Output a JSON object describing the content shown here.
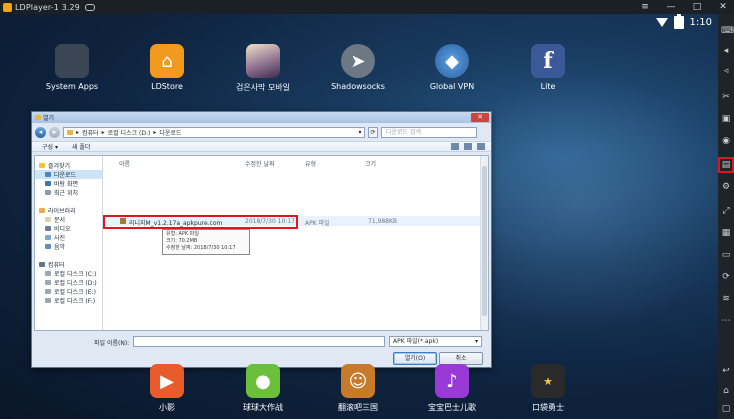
{
  "window": {
    "title": "LDPlayer-1 3.29"
  },
  "statusbar": {
    "time": "1:10"
  },
  "desktop_apps": [
    {
      "label": "System Apps"
    },
    {
      "label": "LDStore"
    },
    {
      "label": "검은사막 모바일"
    },
    {
      "label": "Shadowsocks"
    },
    {
      "label": "Global VPN"
    },
    {
      "label": "Lite"
    }
  ],
  "dock_apps": [
    {
      "label": "小影"
    },
    {
      "label": "球球大作战"
    },
    {
      "label": "翻滚吧三国"
    },
    {
      "label": "宝宝巴士儿歌"
    },
    {
      "label": "口袋勇士"
    }
  ],
  "dialog": {
    "title": "열기",
    "close": "✕",
    "breadcrumb": [
      "컴퓨터",
      "로컬 디스크 (D:)",
      "다운로드"
    ],
    "search_placeholder": "다운로드 검색",
    "toolbar": {
      "organize": "구성 ▾",
      "new_folder": "새 폴더"
    },
    "nav": {
      "favorites": "즐겨찾기",
      "fav_items": [
        "다운로드",
        "바탕 화면",
        "최근 위치"
      ],
      "libraries": "라이브러리",
      "lib_items": [
        "문서",
        "비디오",
        "사진",
        "음악"
      ],
      "computer": "컴퓨터",
      "drives": [
        "로컬 디스크 (C:)",
        "로컬 디스크 (D:)",
        "로컬 디스크 (E:)",
        "로컬 디스크 (F:)"
      ]
    },
    "columns": {
      "name": "이름",
      "modified": "수정한 날짜",
      "type": "유형",
      "size": "크기"
    },
    "file": {
      "name": "리니지M_v1.2.17a_apkpure.com",
      "modified": "2018/7/30 10:17",
      "type": "APK 파일",
      "size": "71,988KB"
    },
    "tooltip": {
      "line1": "유형: APK 파일",
      "line2": "크기: 70.2MB",
      "line3": "수정한 날짜: 2018/7/30 10:17"
    },
    "filename_label": "파일 이름(N):",
    "filter": "APK 파일(*.apk)",
    "open_button": "열기(O)",
    "cancel_button": "취소"
  }
}
